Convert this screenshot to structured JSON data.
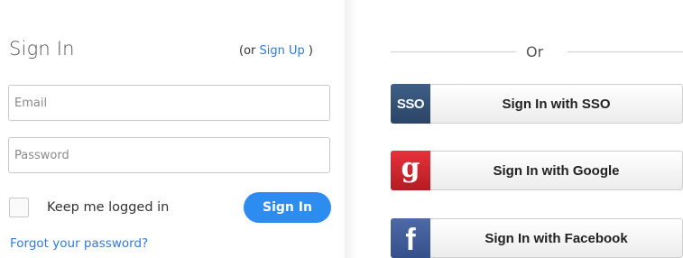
{
  "signin": {
    "title": "Sign In",
    "signup_prefix": "(or ",
    "signup_link": "Sign Up",
    "signup_suffix": " )",
    "email_placeholder": "Email",
    "password_placeholder": "Password",
    "keep_logged_in": "Keep me logged in",
    "signin_button": "Sign In",
    "forgot_password": "Forgot your password?"
  },
  "alt": {
    "or_label": "Or",
    "buttons": [
      {
        "icon_text": "SSO",
        "icon": "sso-icon",
        "label": "Sign In with SSO",
        "color": "#34506f"
      },
      {
        "icon_text": "g",
        "icon": "google-icon",
        "label": "Sign In with Google",
        "color": "#d12a31"
      },
      {
        "icon_text": "f",
        "icon": "facebook-icon",
        "label": "Sign In with Facebook",
        "color": "#3f5c9a"
      }
    ]
  },
  "colors": {
    "accent": "#2d8cf0",
    "link": "#2c7be5"
  }
}
